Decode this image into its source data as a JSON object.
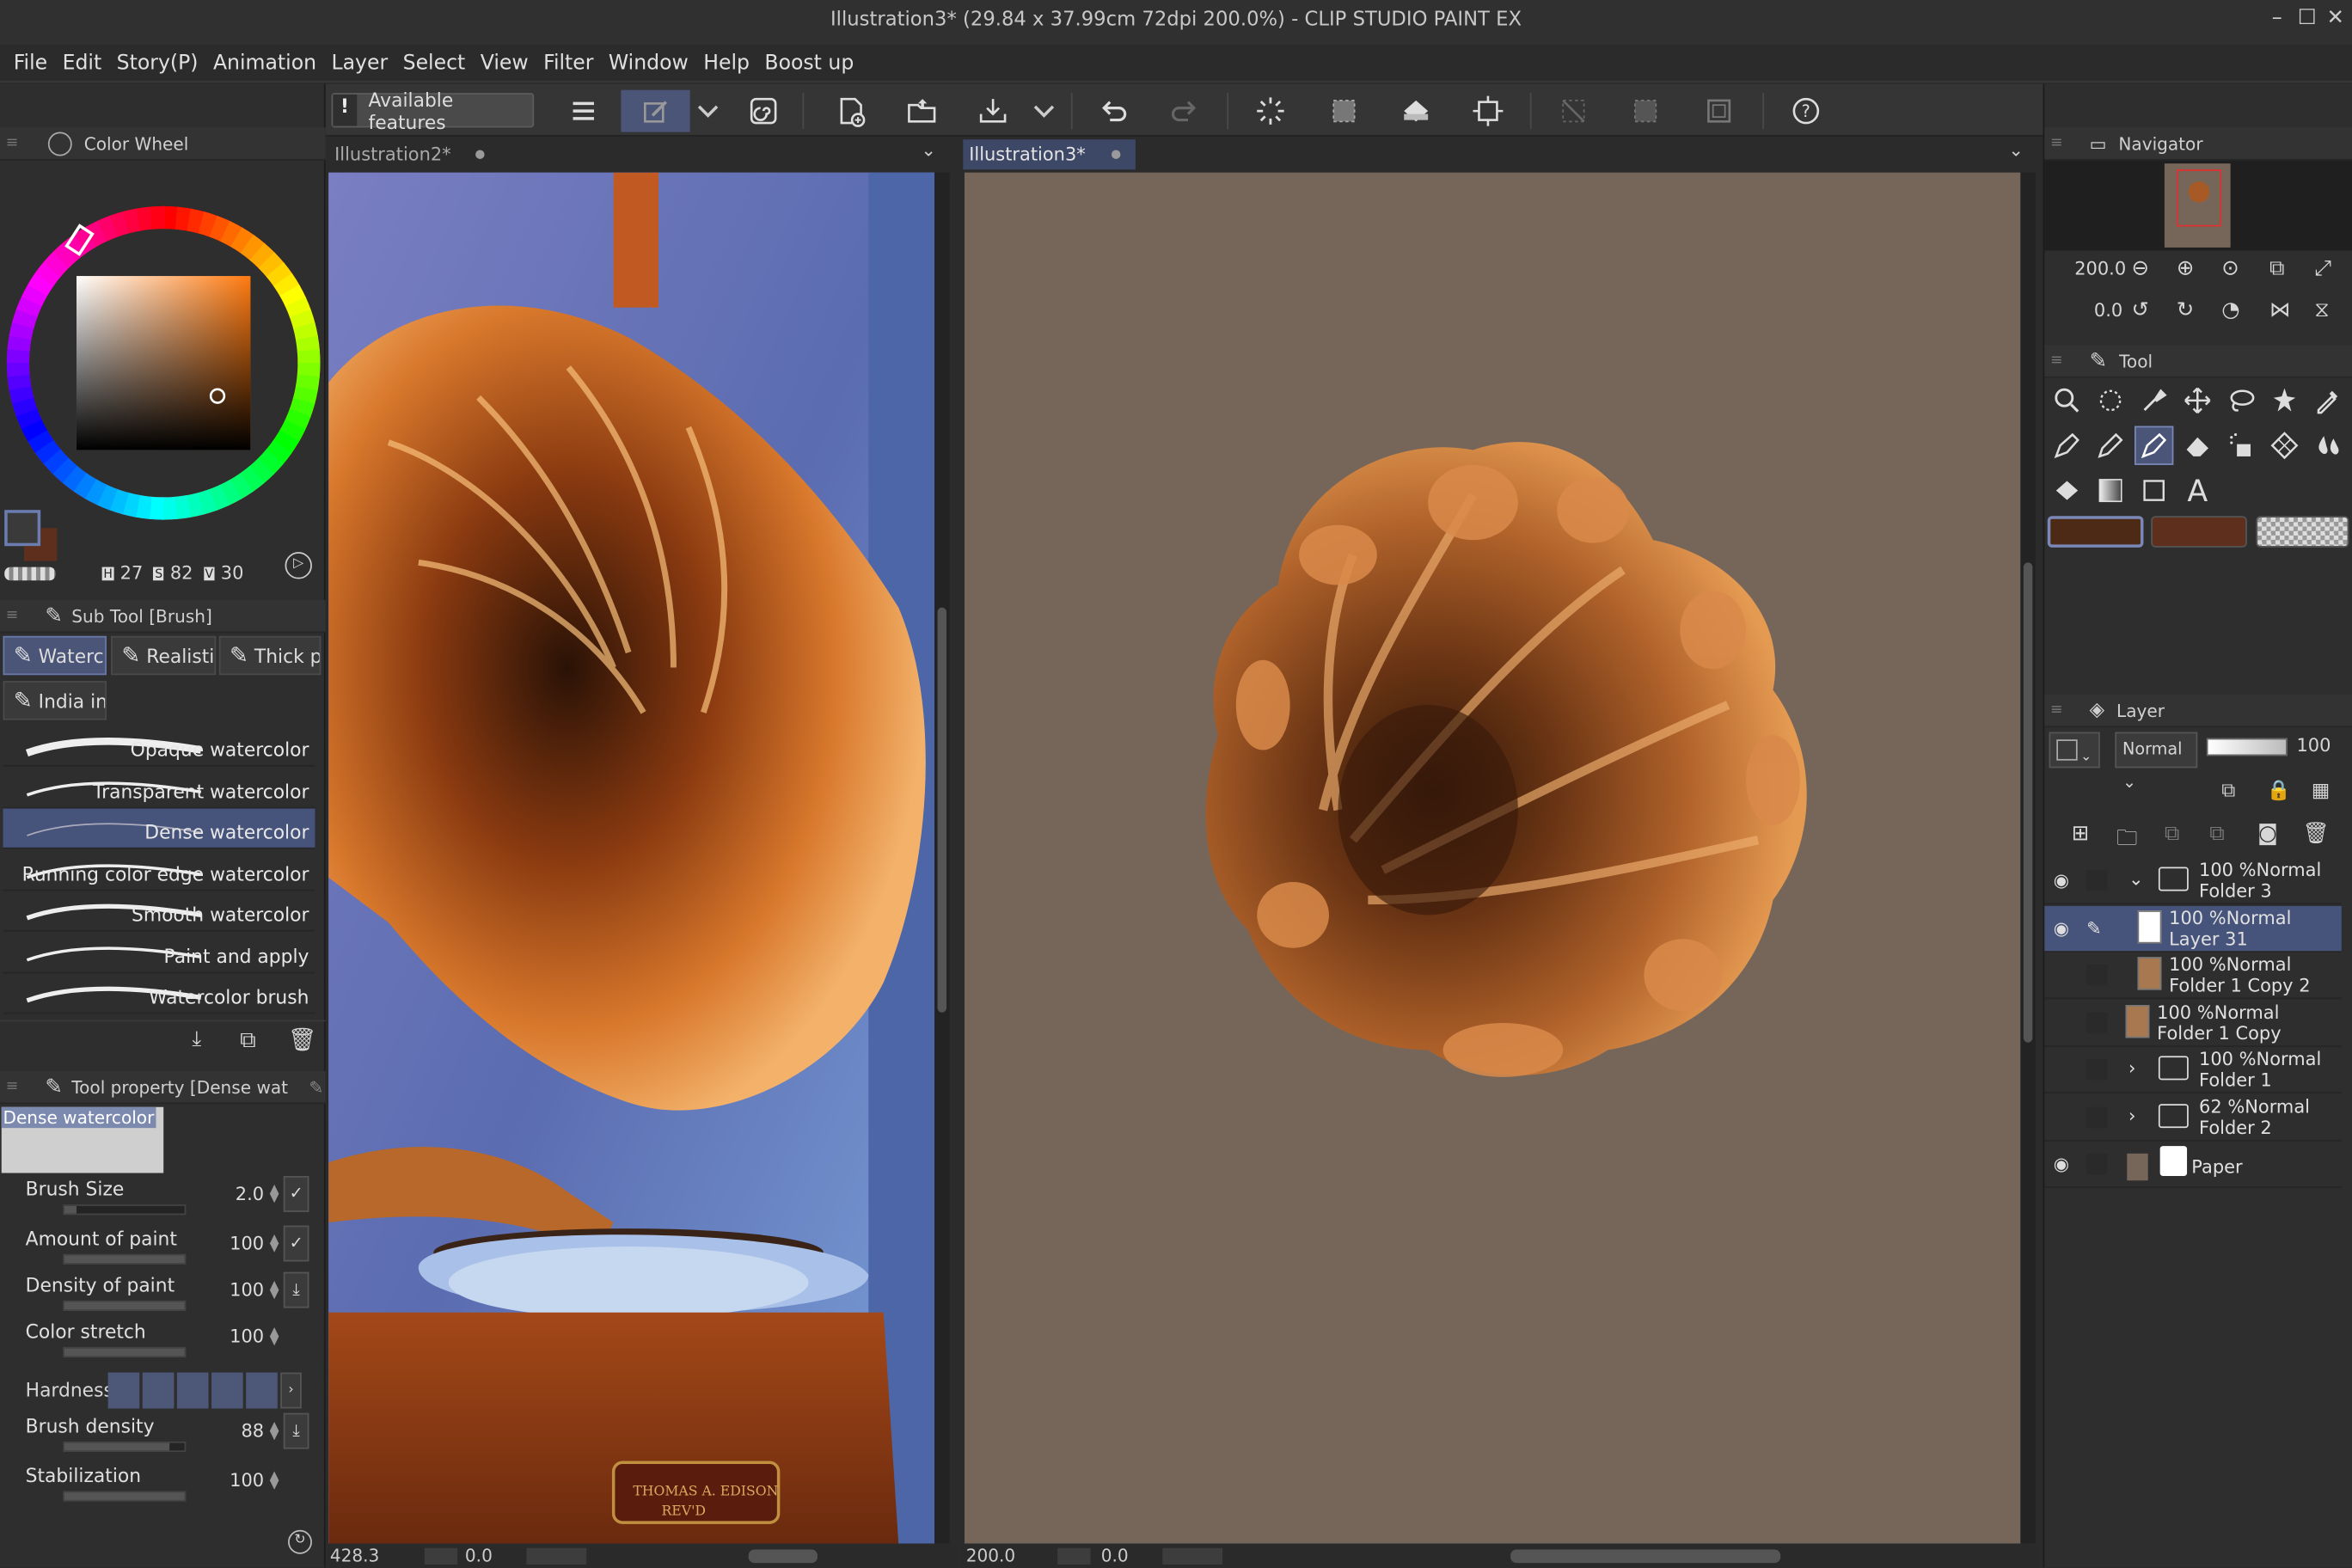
{
  "window": {
    "title": "Illustration3* (29.84 x 37.99cm 72dpi 200.0%)  - CLIP STUDIO PAINT EX"
  },
  "menu": [
    "File",
    "Edit",
    "Story(P)",
    "Animation",
    "Layer",
    "Select",
    "View",
    "Filter",
    "Window",
    "Help",
    "Boost up"
  ],
  "toolbar": {
    "available_features_label": "Available features"
  },
  "color_wheel": {
    "panel_title": "Color Wheel",
    "h_label": "H",
    "h_value": "27",
    "s_label": "S",
    "s_value": "82",
    "v_label": "V",
    "v_value": "30",
    "main_color": "#6b3a22",
    "sub_color": "#3a3a3a"
  },
  "sub_tool": {
    "panel_title": "Sub Tool [Brush]",
    "tabs": [
      "Waterc",
      "Realisti",
      "Thick p",
      "India in"
    ],
    "brushes": [
      "Opaque watercolor",
      "Transparent watercolor",
      "Dense watercolor",
      "Running color edge watercolor",
      "Smooth watercolor",
      "Paint and apply",
      "Watercolor brush"
    ],
    "selected": "Dense watercolor"
  },
  "tool_property": {
    "panel_title": "Tool property [Dense wat",
    "preview_label": "Dense watercolor",
    "props": [
      {
        "label": "Brush Size",
        "value": "2.0",
        "fill": 0.1
      },
      {
        "label": "Amount of paint",
        "value": "100",
        "fill": 1.0
      },
      {
        "label": "Density of paint",
        "value": "100",
        "fill": 1.0
      },
      {
        "label": "Color stretch",
        "value": "100",
        "fill": 1.0
      },
      {
        "label": "Brush density",
        "value": "88",
        "fill": 0.88
      },
      {
        "label": "Stabilization",
        "value": "100",
        "fill": 1.0
      }
    ],
    "hardness_label": "Hardness"
  },
  "documents": {
    "left_tab": "Illustration2*",
    "right_tab": "Illustration3*",
    "left_zoom": "428.3",
    "left_angle": "0.0",
    "right_zoom": "200.0",
    "right_angle": "0.0",
    "right_canvas_color": "#76665a",
    "plaque_text_1": "THOMAS A. EDISON",
    "plaque_text_2": "REV'D"
  },
  "navigator": {
    "panel_title": "Navigator",
    "zoom": "200.0",
    "angle": "0.0"
  },
  "tool_panel": {
    "panel_title": "Tool",
    "main_color": "#4d2a16",
    "sub_color": "#5e2f1d"
  },
  "layer_panel": {
    "panel_title": "Layer",
    "blend_mode": "Normal",
    "opacity": "100",
    "layers": [
      {
        "line1": "100 %Normal",
        "line2": "Folder 3",
        "visible": true,
        "type": "folder",
        "expanded": true,
        "selected": false
      },
      {
        "line1": "100 %Normal",
        "line2": "Layer 31",
        "visible": true,
        "type": "layer",
        "selected": true
      },
      {
        "line1": "100 %Normal",
        "line2": "Folder 1 Copy 2",
        "visible": false,
        "type": "layer",
        "selected": false
      },
      {
        "line1": "100 %Normal",
        "line2": "Folder 1 Copy",
        "visible": false,
        "type": "layer",
        "selected": false
      },
      {
        "line1": "100 %Normal",
        "line2": "Folder 1",
        "visible": false,
        "type": "folder",
        "expanded": false,
        "selected": false
      },
      {
        "line1": "62 %Normal",
        "line2": "Folder 2",
        "visible": false,
        "type": "folder",
        "expanded": false,
        "selected": false
      },
      {
        "line1": "",
        "line2": "Paper",
        "visible": true,
        "type": "paper",
        "selected": false
      }
    ]
  }
}
